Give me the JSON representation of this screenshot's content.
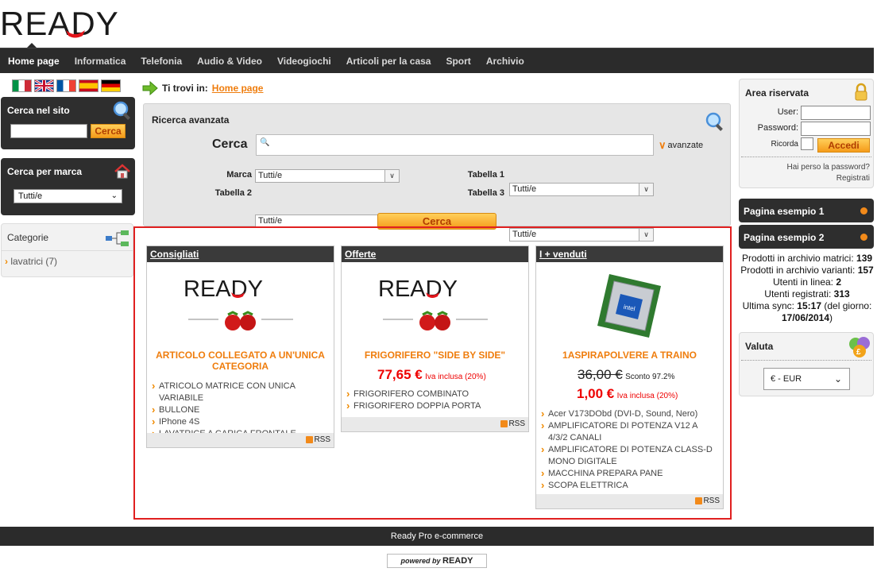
{
  "brand": {
    "logo_text": "READY"
  },
  "nav": {
    "items": [
      "Home page",
      "Informatica",
      "Telefonia",
      "Audio & Video",
      "Videogiochi",
      "Articoli per la casa",
      "Sport",
      "Archivio"
    ]
  },
  "breadcrumb": {
    "prefix": "Ti trovi in:",
    "current": "Home page"
  },
  "left": {
    "search": {
      "title": "Cerca nel sito",
      "button": "Cerca",
      "value": ""
    },
    "brand_search": {
      "title": "Cerca per marca",
      "selected": "Tutti/e"
    },
    "categories": {
      "title": "Categorie",
      "items": [
        "lavatrici (7)"
      ]
    }
  },
  "advanced": {
    "title": "Ricerca avanzata",
    "search_label": "Cerca",
    "avanzate": "avanzate",
    "fields": [
      {
        "label": "Marca",
        "value": "Tutti/e"
      },
      {
        "label": "Tabella 1",
        "value": "Tutti/e"
      },
      {
        "label": "Tabella 2",
        "value": "Tutti/e"
      },
      {
        "label": "Tabella 3",
        "value": "Tutti/e"
      }
    ],
    "button": "Cerca"
  },
  "panels": [
    {
      "header": "Consigliati",
      "logo": "READY",
      "title": "ARTICOLO COLLEGATO A UN'UNICA CATEGORIA",
      "items": [
        "ATRICOLO MATRICE CON UNICA VARIABILE",
        "BULLONE",
        "IPhone 4S",
        "LAVATRICE A CARICA FRONTALE"
      ],
      "rss": "RSS"
    },
    {
      "header": "Offerte",
      "logo": "READY",
      "title": "FRIGORIFERO \"SIDE BY SIDE\"",
      "price": "77,65 €",
      "iva": "Iva inclusa (20%)",
      "items": [
        "FRIGORIFERO COMBINATO",
        "FRIGORIFERO DOPPIA PORTA"
      ],
      "rss": "RSS"
    },
    {
      "header": "I + venduti",
      "title": "1ASPIRAPOLVERE A TRAINO",
      "old_price": "36,00 €",
      "discount": "Sconto 97.2%",
      "price": "1,00 €",
      "iva": "Iva inclusa (20%)",
      "items": [
        "Acer V173DObd (DVI-D, Sound, Nero)",
        "AMPLIFICATORE DI POTENZA V12 A 4/3/2 CANALI",
        "AMPLIFICATORE DI POTENZA CLASS-D MONO DIGITALE",
        "MACCHINA PREPARA PANE",
        "SCOPA ELETTRICA"
      ],
      "rss": "RSS"
    }
  ],
  "right": {
    "login": {
      "title": "Area riservata",
      "user_label": "User:",
      "password_label": "Password:",
      "remember_label": "Ricorda",
      "button": "Accedi",
      "forgot": "Hai perso la password?",
      "register": "Registrati"
    },
    "pages": [
      "Pagina esempio 1",
      "Pagina esempio 2"
    ],
    "stats": [
      {
        "label": "Prodotti in archivio matrici:",
        "value": "139"
      },
      {
        "label": "Prodotti in archivio varianti:",
        "value": "157"
      },
      {
        "label": "Utenti in linea:",
        "value": "2"
      },
      {
        "label": "Utenti registrati:",
        "value": "313"
      }
    ],
    "sync": {
      "label": "Ultima sync:",
      "time": "15:17",
      "middle": "(del giorno:",
      "date": "17/06/2014",
      "end": ")"
    },
    "currency": {
      "title": "Valuta",
      "selected": "€ - EUR"
    }
  },
  "footer": {
    "text": "Ready Pro e-commerce",
    "powered_prefix": "powered by",
    "powered_brand": "READY"
  },
  "colors": {
    "accent": "#ef7d0d",
    "nav_bg": "#2b2b2b",
    "price_red": "#e00000",
    "highlight_red": "#e02020"
  }
}
